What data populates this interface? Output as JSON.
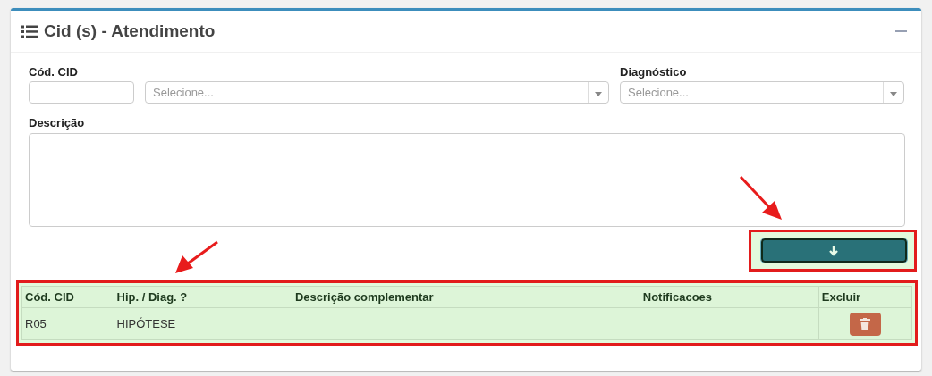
{
  "panel": {
    "title": "Cid (s) - Atendimento"
  },
  "form": {
    "code_label": "Cód. CID",
    "code_select_placeholder": "Selecione...",
    "diagnosis_label": "Diagnóstico",
    "diagnosis_placeholder": "Selecione...",
    "description_label": "Descrição"
  },
  "table": {
    "columns": [
      "Cód. CID",
      "Hip. / Diag. ?",
      "Descrição complementar",
      "Notificacoes",
      "Excluir"
    ],
    "rows": [
      {
        "code": "R05",
        "type": "HIPÓTESE",
        "description": "",
        "notifications": ""
      }
    ]
  }
}
